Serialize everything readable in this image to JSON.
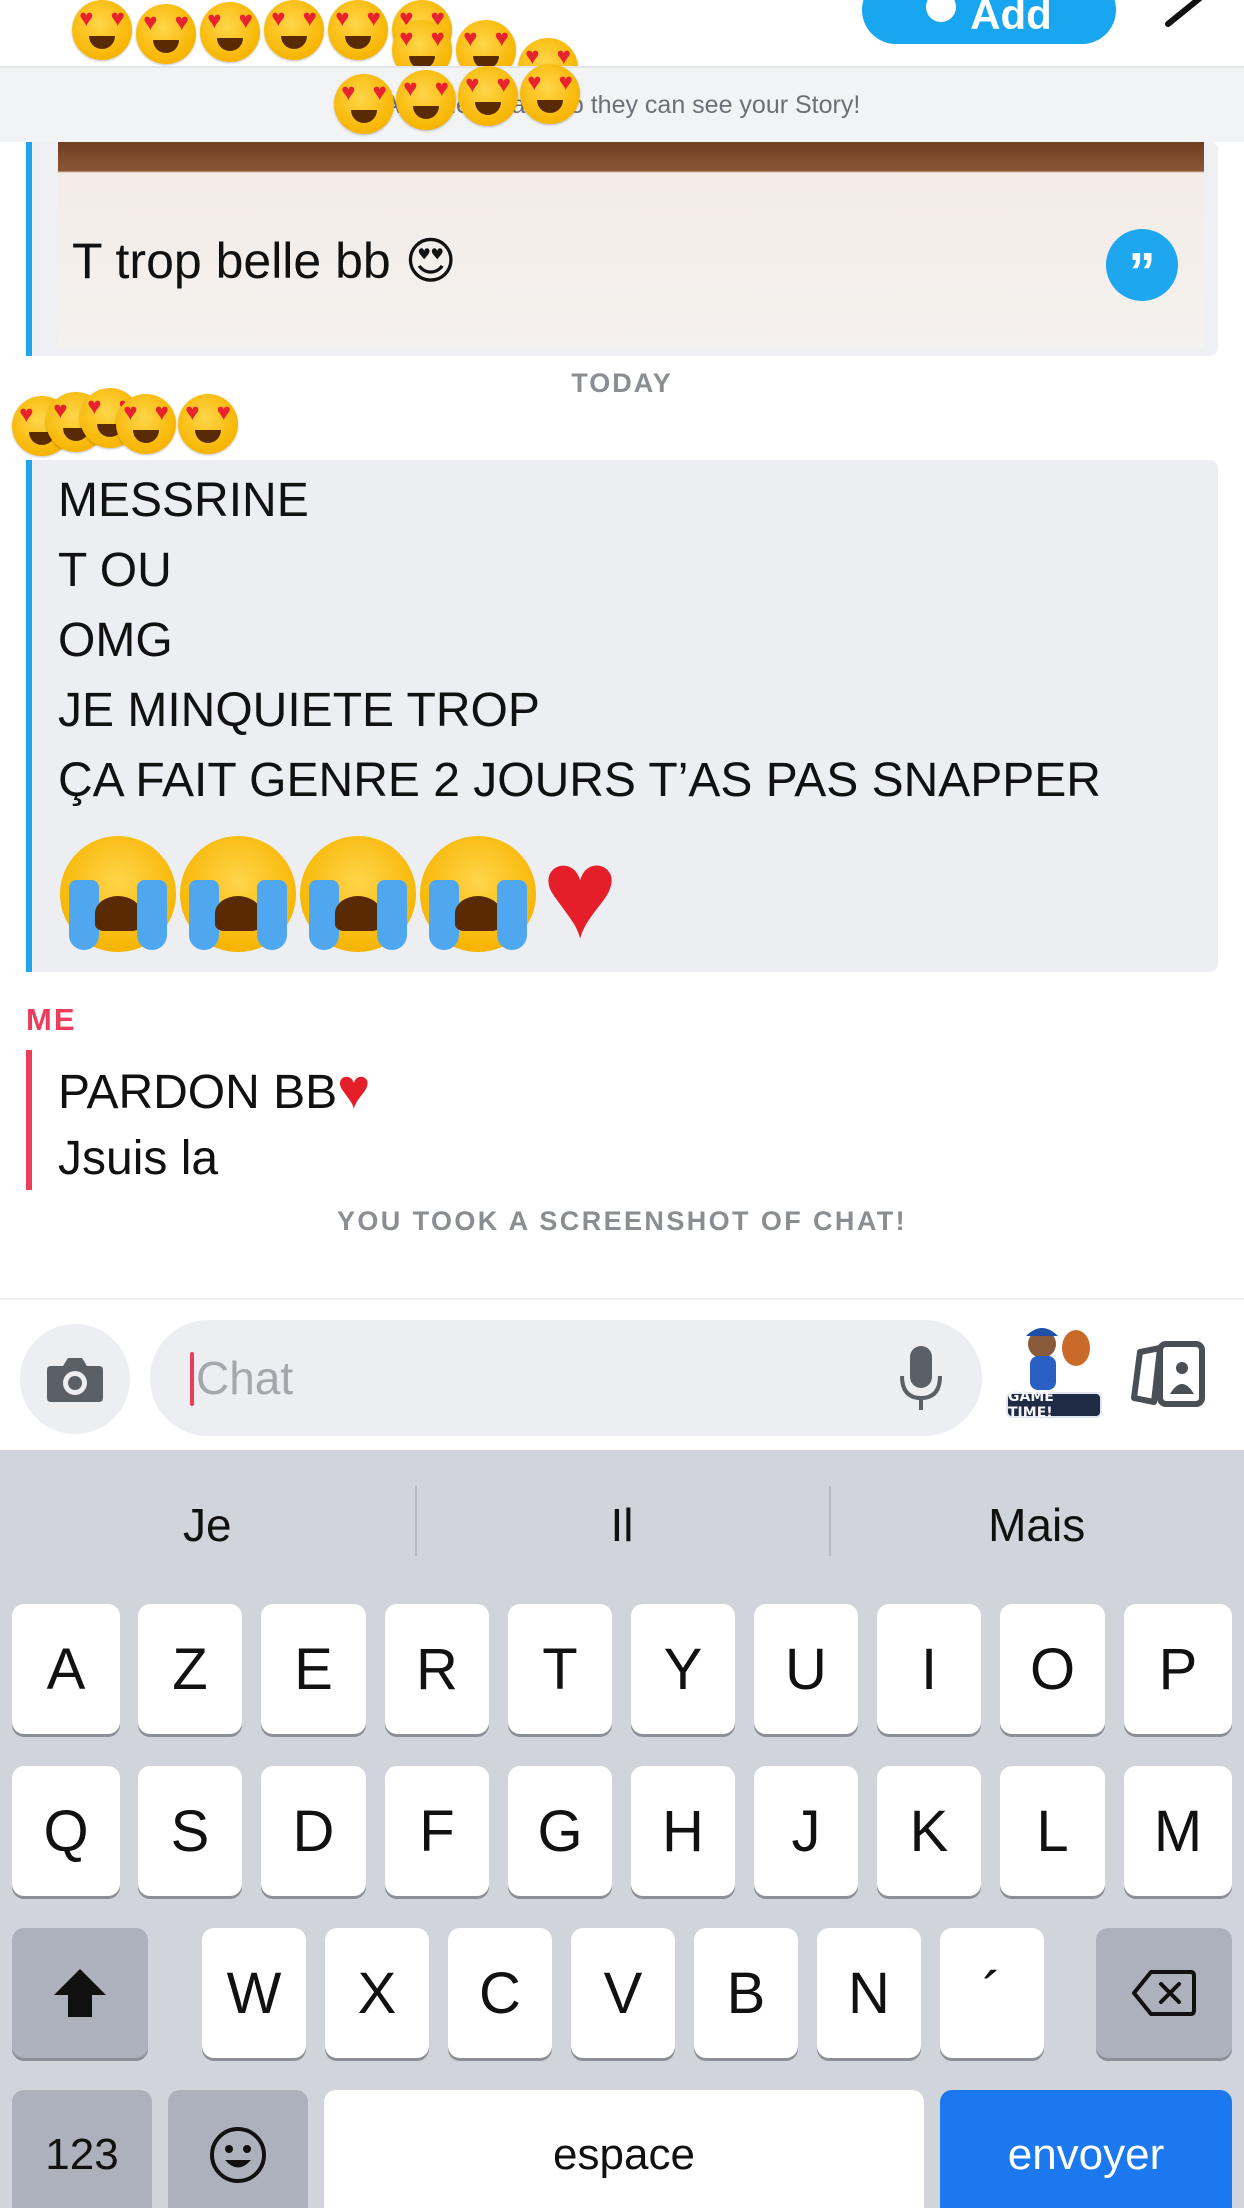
{
  "header": {
    "add_label": "Add",
    "story_banner": "Add them back so they can see your Story!"
  },
  "chat": {
    "quoted": {
      "text": "T trop belle bb 😍",
      "quote_icon": "quote-icon"
    },
    "day_label": "TODAY",
    "friend_message": {
      "lines": [
        "MESSRINE",
        "T OU",
        "OMG",
        "JE MINQUIETE TROP",
        "ÇA FAIT GENRE 2 JOURS T’AS PAS SNAPPER"
      ],
      "emojis": [
        "crying-face",
        "crying-face",
        "crying-face",
        "crying-face",
        "red-heart"
      ]
    },
    "me": {
      "label": "ME",
      "lines": [
        "PARDON BB",
        "Jsuis la"
      ]
    },
    "screenshot_note": "YOU TOOK A SCREENSHOT OF CHAT!"
  },
  "input": {
    "placeholder": "Chat",
    "bitmoji_caption": "GAME TIME!"
  },
  "keyboard": {
    "suggestions": [
      "Je",
      "Il",
      "Mais"
    ],
    "row1": [
      "A",
      "Z",
      "E",
      "R",
      "T",
      "Y",
      "U",
      "I",
      "O",
      "P"
    ],
    "row2": [
      "Q",
      "S",
      "D",
      "F",
      "G",
      "H",
      "J",
      "K",
      "L",
      "M"
    ],
    "row3": [
      "W",
      "X",
      "C",
      "V",
      "B",
      "N",
      "´"
    ],
    "numbers_label": "123",
    "space_label": "espace",
    "send_label": "envoyer"
  },
  "colors": {
    "friend_accent": "#1ea7ef",
    "me_accent": "#ee3d5c",
    "send_key": "#1b78ef"
  }
}
